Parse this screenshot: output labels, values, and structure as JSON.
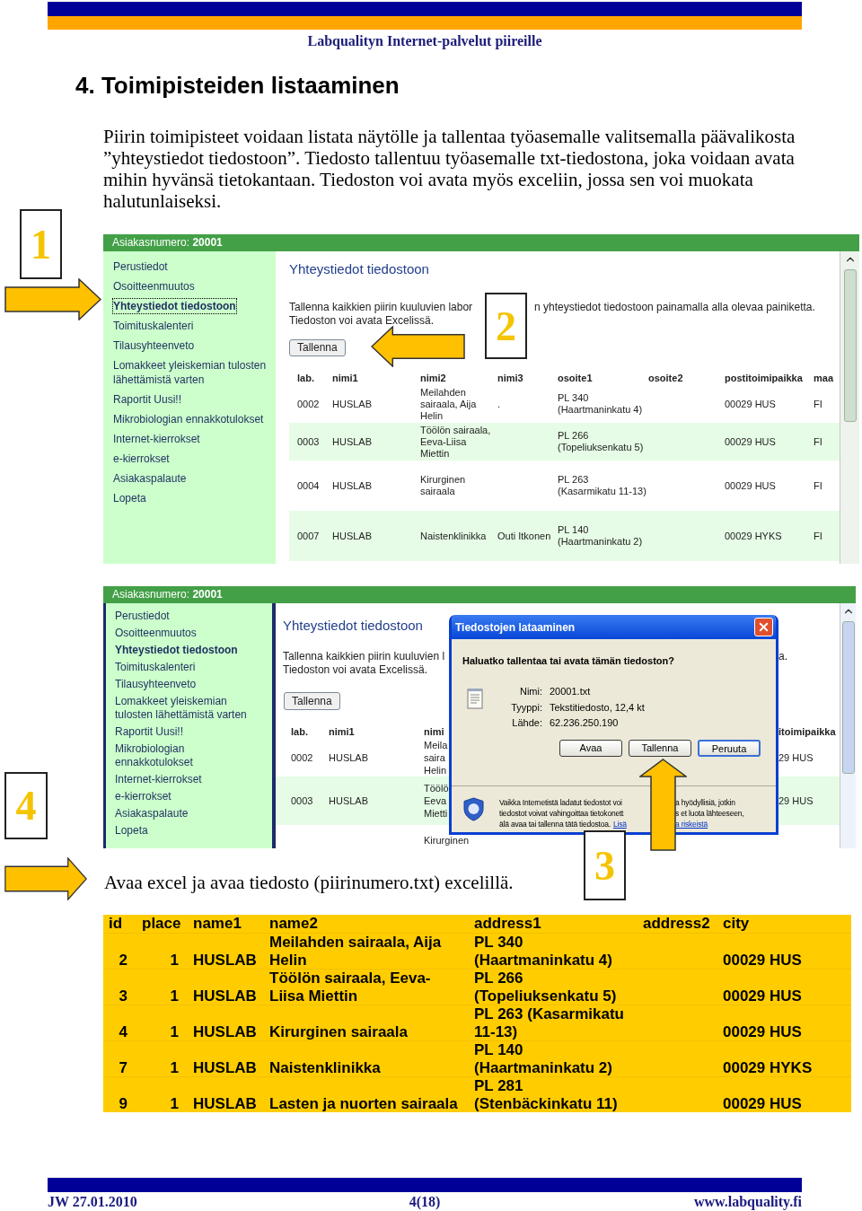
{
  "header": {
    "title": "Labqualityn Internet-palvelut piireille"
  },
  "heading": "4. Toimipisteiden listaaminen",
  "intro": "Piirin toimipisteet voidaan listata näytölle ja tallentaa työasemalle valitsemalla päävalikosta ”yhteystiedot tiedostoon”. Tiedosto tallentuu työasemalle txt-tiedostona, joka voidaan avata mihin hyvänsä tietokantaan. Tiedoston voi avata myös exceliin, jossa sen voi muokata halutunlaiseksi.",
  "callouts": [
    {
      "number": "1"
    },
    {
      "number": "2"
    },
    {
      "number": "4"
    },
    {
      "number": "3"
    }
  ],
  "screen_1": {
    "customer": "Asiakasnumero: **20001**",
    "sidebar": {
      "items": [
        {
          "label": "Perustiedot",
          "selected": false
        },
        {
          "label": "Osoitteenmuutos",
          "selected": false
        },
        {
          "label": "Yhteystiedot tiedostoon",
          "selected": true
        },
        {
          "label": "Toimituskalenteri",
          "selected": false
        },
        {
          "label": "Tilausyhteenveto",
          "selected": false
        },
        {
          "label": "Lomakkeet yleiskemian tulosten lähettämistä varten",
          "selected": false
        },
        {
          "label": "Raportit Uusi!!",
          "selected": false
        },
        {
          "label": "Mikrobiologian ennakkotulokset",
          "selected": false
        },
        {
          "label": "Internet-kierrokset",
          "selected": false
        },
        {
          "label": "e-kierrokset",
          "selected": false
        },
        {
          "label": "Asiakaspalaute",
          "selected": false
        },
        {
          "label": "Lopeta",
          "selected": false
        }
      ]
    },
    "title": "Yhteystiedot tiedostoon",
    "description_left": "Tallenna kaikkien piirin kuuluvien labor",
    "description_right": "n yhteystiedot tiedostoon painamalla alla olevaa painiketta.",
    "description_line2": "Tiedoston voi avata Excelissä.",
    "button": "Tallenna",
    "table": {
      "columns": [
        "lab.",
        "nimi1",
        "nimi2",
        "nimi3",
        "osoite1",
        "osoite2",
        "postitoimipaikka",
        "maa"
      ],
      "rows": [
        {
          "lab": "0002",
          "nimi1": "HUSLAB",
          "nimi2": "Meilahden sairaala, Aija Helin",
          "nimi3": ".",
          "osoite1": "PL 340 (Haartmaninkatu 4)",
          "postitoimipaikka": "00029 HUS",
          "maa": "FI"
        },
        {
          "lab": "0003",
          "nimi1": "HUSLAB",
          "nimi2": "Töölön sairaala, Eeva-Liisa Miettin",
          "osoite1": "PL 266 (Topeliuksenkatu 5)",
          "postitoimipaikka": "00029 HUS",
          "maa": "FI"
        },
        {
          "lab": "0004",
          "nimi1": "HUSLAB",
          "nimi2": "Kirurginen sairaala",
          "osoite1": "PL 263 (Kasarmikatu 11-13)",
          "postitoimipaikka": "00029 HUS",
          "maa": "FI"
        },
        {
          "lab": "0007",
          "nimi1": "HUSLAB",
          "nimi2": "Naistenklinikka",
          "nimi3": "Outi Itkonen",
          "osoite1": "PL 140 (Haartmaninkatu 2)",
          "postitoimipaikka": "00029 HYKS",
          "maa": "FI"
        }
      ]
    }
  },
  "screen_2": {
    "customer": "Asiakasnumero: **20001**",
    "sidebar": {
      "items": [
        {
          "label": "Perustiedot",
          "selected": false
        },
        {
          "label": "Osoitteenmuutos",
          "selected": false
        },
        {
          "label": "Yhteystiedot tiedostoon",
          "selected": true
        },
        {
          "label": "Toimituskalenteri",
          "selected": false
        },
        {
          "label": "Tilausyhteenveto",
          "selected": false
        },
        {
          "label": "Lomakkeet yleiskemian tulosten lähettämistä varten",
          "selected": false
        },
        {
          "label": "Raportit Uusi!!",
          "selected": false
        },
        {
          "label": "Mikrobiologian ennakkotulokset",
          "selected": false
        },
        {
          "label": "Internet-kierrokset",
          "selected": false
        },
        {
          "label": "e-kierrokset",
          "selected": false
        },
        {
          "label": "Asiakaspalaute",
          "selected": false
        },
        {
          "label": "Lopeta",
          "selected": false
        }
      ]
    },
    "title": "Yhteystiedot tiedostoon",
    "description_line1": "Tallenna kaikkien piirin kuuluvien l",
    "description_tail": "a.",
    "description_line2": "Tiedoston voi avata Excelissä.",
    "button": "Tallenna",
    "table": {
      "columns": [
        "lab.",
        "nimi1",
        "nimi"
      ],
      "column_right": "itoimipaikka",
      "rows": [
        {
          "lab": "0002",
          "nimi1": "HUSLAB",
          "nimi2_lines": [
            "Meila",
            "saira",
            "Helin"
          ],
          "right": "29 HUS"
        },
        {
          "lab": "0003",
          "nimi1": "HUSLAB",
          "nimi2_lines": [
            "Töölö",
            "Eeva",
            "Mietti"
          ],
          "right": "29 HUS"
        }
      ],
      "partial_row": "Kirurginen"
    },
    "dialog": {
      "title": "Tiedostojen lataaminen",
      "question": "Haluatko tallentaa tai avata tämän tiedoston?",
      "fields": [
        {
          "label": "Nimi:",
          "value": "20001.txt"
        },
        {
          "label": "Tyyppi:",
          "value": "Tekstitiedosto, 12,4 kt"
        },
        {
          "label": "Lähde:",
          "value": "62.236.250.190"
        }
      ],
      "buttons": [
        {
          "label": "Avaa",
          "default": false
        },
        {
          "label": "Tallenna",
          "default": false
        },
        {
          "label": "Peruuta",
          "default": true
        }
      ],
      "warning": [
        {
          "left": "Vaikka Internetistä ladatut tiedostot voi",
          "right": "a hyödyllisiä, jotkin"
        },
        {
          "left": "tiedostot voivat vahingoittaa tietokonett",
          "right": "s et luota lähteeseen,"
        },
        {
          "left": "älä avaa tai tallenna tätä tiedostoa.",
          "left_link": "Lisä",
          "right_link": "a riskeistä"
        }
      ]
    }
  },
  "caption": "Avaa excel ja avaa tiedosto (piirinumero.txt) excelillä.",
  "excel_table": {
    "columns": [
      "id",
      "place",
      "name1",
      "name2",
      "address1",
      "address2",
      "city"
    ],
    "rows": [
      {
        "id": "2",
        "place": "1",
        "name1": "HUSLAB",
        "name2": "Meilahden sairaala, Aija Helin",
        "address1": "PL 340 (Haartmaninkatu 4)",
        "city": "00029 HUS"
      },
      {
        "id": "3",
        "place": "1",
        "name1": "HUSLAB",
        "name2": "Töölön sairaala, Eeva-Liisa Miettin",
        "address1": "PL 266 (Topeliuksenkatu 5)",
        "city": "00029 HUS"
      },
      {
        "id": "4",
        "place": "1",
        "name1": "HUSLAB",
        "name2": "Kirurginen sairaala",
        "address1": "PL 263 (Kasarmikatu 11-13)",
        "city": "00029 HUS"
      },
      {
        "id": "7",
        "place": "1",
        "name1": "HUSLAB",
        "name2": "Naistenklinikka",
        "address1": "PL 140 (Haartmaninkatu 2)",
        "city": "00029 HYKS"
      },
      {
        "id": "9",
        "place": "1",
        "name1": "HUSLAB",
        "name2": "Lasten ja nuorten sairaala",
        "address1": "PL 281 (Stenbäckinkatu 11)",
        "city": "00029 HUS"
      }
    ]
  },
  "footer": {
    "left": "JW 27.01.2010",
    "center": "4(18)",
    "right": "www.labquality.fi"
  }
}
